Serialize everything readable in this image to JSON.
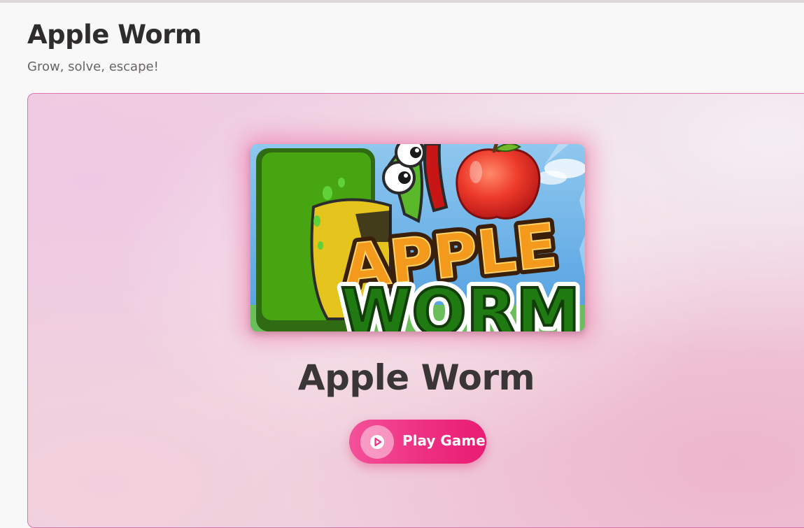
{
  "header": {
    "title": "Apple Worm",
    "subtitle": "Grow, solve, escape!"
  },
  "game_card": {
    "thumbnail_logo_line1": "APPLE",
    "thumbnail_logo_line2": "WORM",
    "title": "Apple Worm",
    "play_button_label": "Play Game",
    "play_icon": "play-circle-icon"
  },
  "colors": {
    "accent": "#ee2f81",
    "card_border": "#d873b0",
    "title_text": "#2f2c2d"
  }
}
